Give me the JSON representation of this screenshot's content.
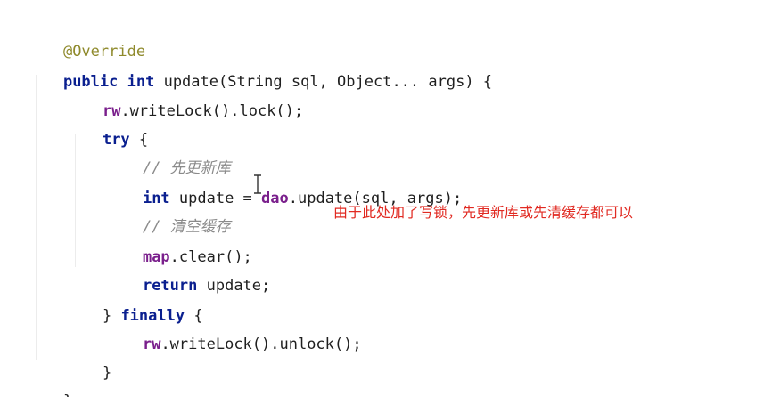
{
  "code": {
    "annotation": "@Override",
    "signature": {
      "kw_public": "public",
      "kw_int": "int",
      "rest": " update(String sql, Object... args) {"
    },
    "lock_line": {
      "obj": "rw",
      "rest": ".writeLock().lock();"
    },
    "try_line": {
      "kw": "try",
      "rest": " {"
    },
    "comment_1": {
      "slashes": "// ",
      "text": "先更新库"
    },
    "update_line": {
      "kw": "int",
      "mid": " update = ",
      "obj": "dao",
      "rest": ".update(sql, args);"
    },
    "comment_2": {
      "slashes": "// ",
      "text": "清空缓存"
    },
    "clear_line": {
      "obj": "map",
      "rest": ".clear();"
    },
    "return_line": {
      "kw": "return",
      "rest": " update;"
    },
    "finally_line": {
      "pre": "} ",
      "kw": "finally",
      "rest": " {"
    },
    "unlock_line": {
      "obj": "rw",
      "rest": ".writeLock().unlock();"
    },
    "close_inner": "}",
    "close_outer": "}"
  },
  "annotation_note": "由于此处加了写锁，先更新库或先清缓存都可以",
  "colors": {
    "keyword": "#0a1f8f",
    "field": "#7a1f8c",
    "annotation": "#8f8a2c",
    "comment": "#8a8a8a",
    "note": "#e12a22"
  },
  "cursor_icon": "text-cursor-icon"
}
